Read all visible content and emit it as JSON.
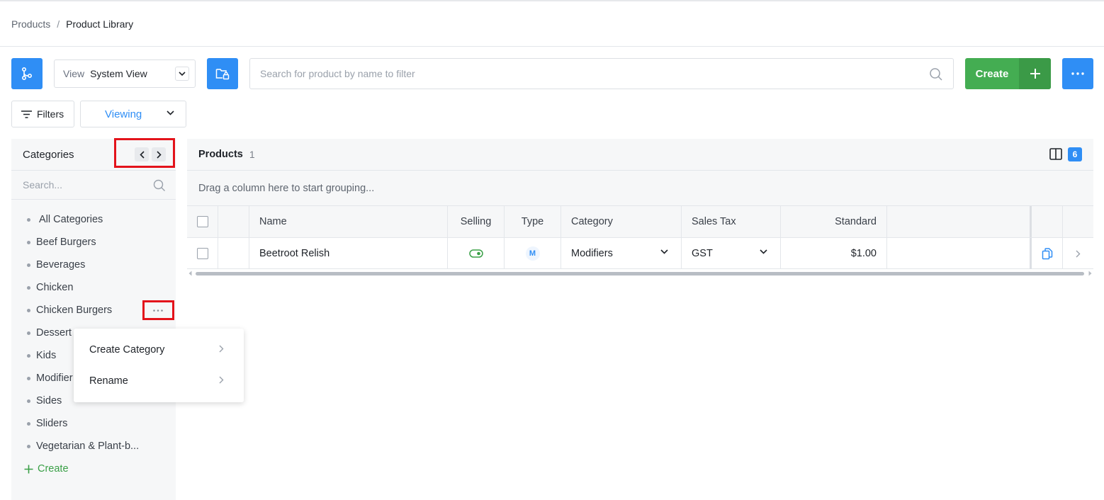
{
  "breadcrumb": {
    "parent": "Products",
    "separator": "/",
    "current": "Product Library"
  },
  "toolbar": {
    "view_label": "View",
    "view_value": "System View",
    "search_placeholder": "Search for product by name to filter",
    "create_label": "Create",
    "filters_label": "Filters",
    "viewing_label": "Viewing",
    "accent_color": "#2f8ef5",
    "create_color": "#44ad52"
  },
  "categories": {
    "title": "Categories",
    "search_placeholder": "Search...",
    "items": [
      "All Categories",
      "Beef Burgers",
      "Beverages",
      "Chicken",
      "Chicken Burgers",
      "Dessert",
      "Kids",
      "Modifier",
      "Sides",
      "Sliders",
      "Vegetarian & Plant-b..."
    ],
    "create_label": "Create"
  },
  "context_menu": {
    "items": [
      "Create Category",
      "Rename"
    ]
  },
  "products": {
    "title": "Products",
    "count": "1",
    "column_badge": "6",
    "group_hint": "Drag a column here to start grouping...",
    "columns": {
      "name": "Name",
      "selling": "Selling",
      "type": "Type",
      "category": "Category",
      "sales_tax": "Sales Tax",
      "standard": "Standard"
    },
    "rows": [
      {
        "name": "Beetroot Relish",
        "selling": true,
        "type": "M",
        "category": "Modifiers",
        "sales_tax": "GST",
        "standard": "$1.00"
      }
    ]
  },
  "highlight_color": "#e3131b"
}
